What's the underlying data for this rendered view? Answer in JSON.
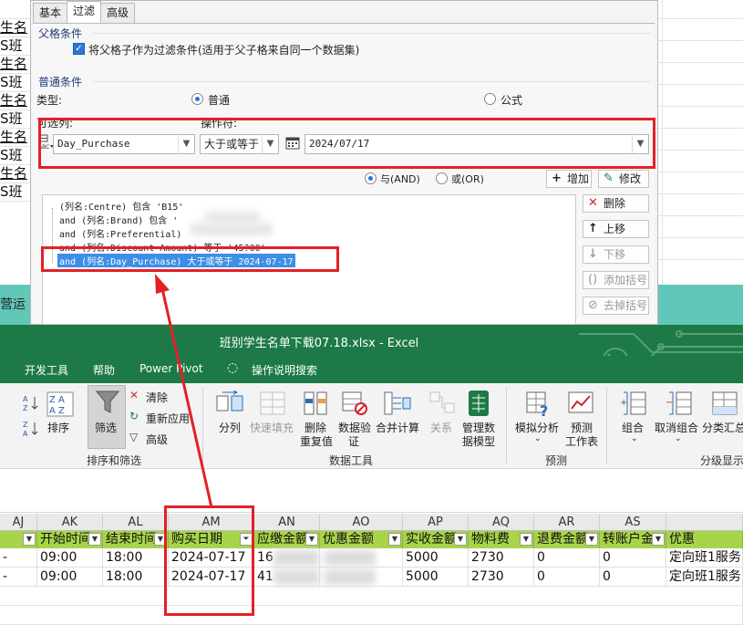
{
  "background": {
    "left_cells": [
      "",
      "生名",
      "S班",
      "生名",
      "S班",
      "生名",
      "S班",
      "生名",
      "S班",
      "生名",
      "S班"
    ],
    "teal_text": "营运"
  },
  "dialog": {
    "tabs": [
      {
        "label": "基本",
        "active": false
      },
      {
        "label": "过滤",
        "active": true
      },
      {
        "label": "高级",
        "active": false
      }
    ],
    "parent_section": {
      "title": "父格条件",
      "checkbox_label": "将父格子作为过滤条件(适用于父子格来自同一个数据集)",
      "checked": true
    },
    "general_section": {
      "title": "普通条件",
      "type_label": "类型:",
      "type_normal": "普通",
      "type_formula": "公式",
      "column_label": "可选列:",
      "operator_label": "操作符:",
      "column_value": "Day_Purchase",
      "operator_value": "大于或等于",
      "date_value": "2024/07/17"
    },
    "logic": {
      "and_label": "与(AND)",
      "or_label": "或(OR)",
      "selected": "and"
    },
    "buttons": {
      "add": "增加",
      "modify": "修改",
      "delete": "删除",
      "up": "上移",
      "down": "下移",
      "add_bracket": "添加括号",
      "remove_bracket": "去掉括号"
    },
    "conditions": [
      "(列名:Centre) 包含 'B15'",
      "and (列名:Brand) 包含 '",
      "and (列名:Preferential)",
      "and (列名:Discount Amount) 等于 '45?00'",
      "and (列名:Day_Purchase) 大于或等于 2024-07-17"
    ]
  },
  "excel": {
    "title": "班别学生名单下载07.18.xlsx  -  Excel",
    "menu": [
      "开发工具",
      "帮助",
      "Power Pivot",
      "操作说明搜索"
    ],
    "ribbon": {
      "sort": "排序",
      "filter": "筛选",
      "clear": "清除",
      "reapply": "重新应用",
      "advanced": "高级",
      "group_sort_filter": "排序和筛选",
      "split": "分列",
      "flash_fill": "快速填充",
      "remove_dup_1": "删除",
      "remove_dup_2": "重复值",
      "validation_1": "数据验",
      "validation_2": "证",
      "consolidate": "合并计算",
      "relations": "关系",
      "data_model_1": "管理数",
      "data_model_2": "据模型",
      "group_data_tools": "数据工具",
      "whatif": "模拟分析",
      "forecast_1": "预测",
      "forecast_2": "工作表",
      "group_forecast": "预测",
      "group_btn": "组合",
      "ungroup_btn": "取消组合",
      "subtotal": "分类汇总",
      "group_outline": "分级显示"
    },
    "columns": [
      "AJ",
      "AK",
      "AL",
      "AM",
      "AN",
      "AO",
      "AP",
      "AQ",
      "AR",
      "AS",
      ""
    ],
    "headers": [
      "",
      "开始时间",
      "结束时间",
      "购买日期",
      "应缴金额",
      "优惠金额",
      "实收金额",
      "物料费",
      "退费金额",
      "转账户金",
      "优惠"
    ],
    "rows": [
      [
        "-",
        "09:00",
        "18:00",
        "2024-07-17",
        "16",
        "",
        "5000",
        "2730",
        "0",
        "0",
        "定向班1服务"
      ],
      [
        "-",
        "09:00",
        "18:00",
        "2024-07-17",
        "41",
        "",
        "5000",
        "2730",
        "0",
        "0",
        "定向班1服务"
      ]
    ]
  }
}
